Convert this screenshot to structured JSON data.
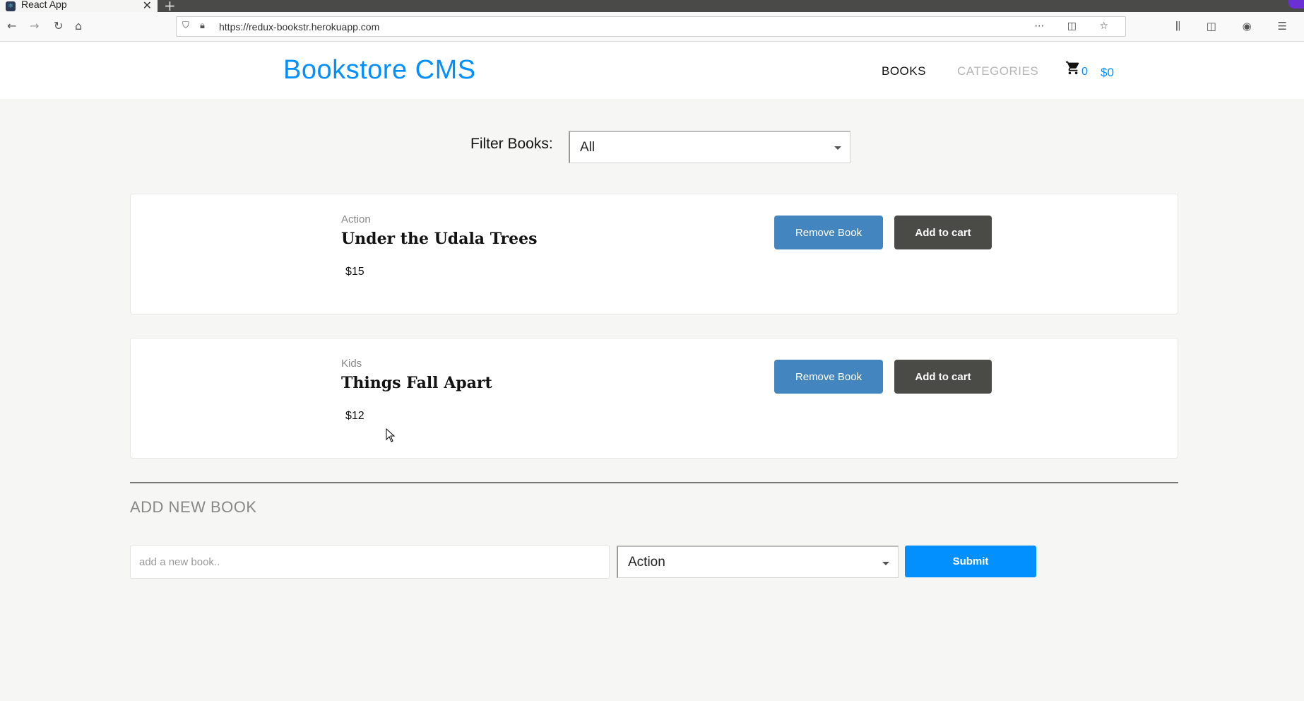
{
  "browser": {
    "tab_title": "React App",
    "tab_close": "✕",
    "new_tab": "+",
    "url": "https://redux-bookstr.herokuapp.com",
    "nav": {
      "back": "←",
      "forward": "→",
      "reload": "↻",
      "home": "⌂"
    },
    "url_actions": "⋯ ◫ ☆",
    "right_tools": "⫼ ◫ ◉ ☰"
  },
  "header": {
    "logo": "Bookstore CMS",
    "nav_books": "BOOKS",
    "nav_categories": "CATEGORIES",
    "cart_count": "0",
    "cart_total": "$0"
  },
  "filter": {
    "label": "Filter Books:",
    "selected": "All"
  },
  "books": [
    {
      "category": "Action",
      "title": "Under the Udala Trees",
      "price": "$15",
      "remove_label": "Remove Book",
      "cart_label": "Add to cart"
    },
    {
      "category": "Kids",
      "title": "Things Fall Apart",
      "price": "$12",
      "remove_label": "Remove Book",
      "cart_label": "Add to cart"
    }
  ],
  "add_book": {
    "title": "ADD NEW BOOK",
    "input_placeholder": "add a new book..",
    "category_selected": "Action",
    "submit_label": "Submit"
  },
  "colors": {
    "brand": "#0290ff",
    "remove_button": "#4386bf",
    "cart_button": "#4a4a47"
  }
}
